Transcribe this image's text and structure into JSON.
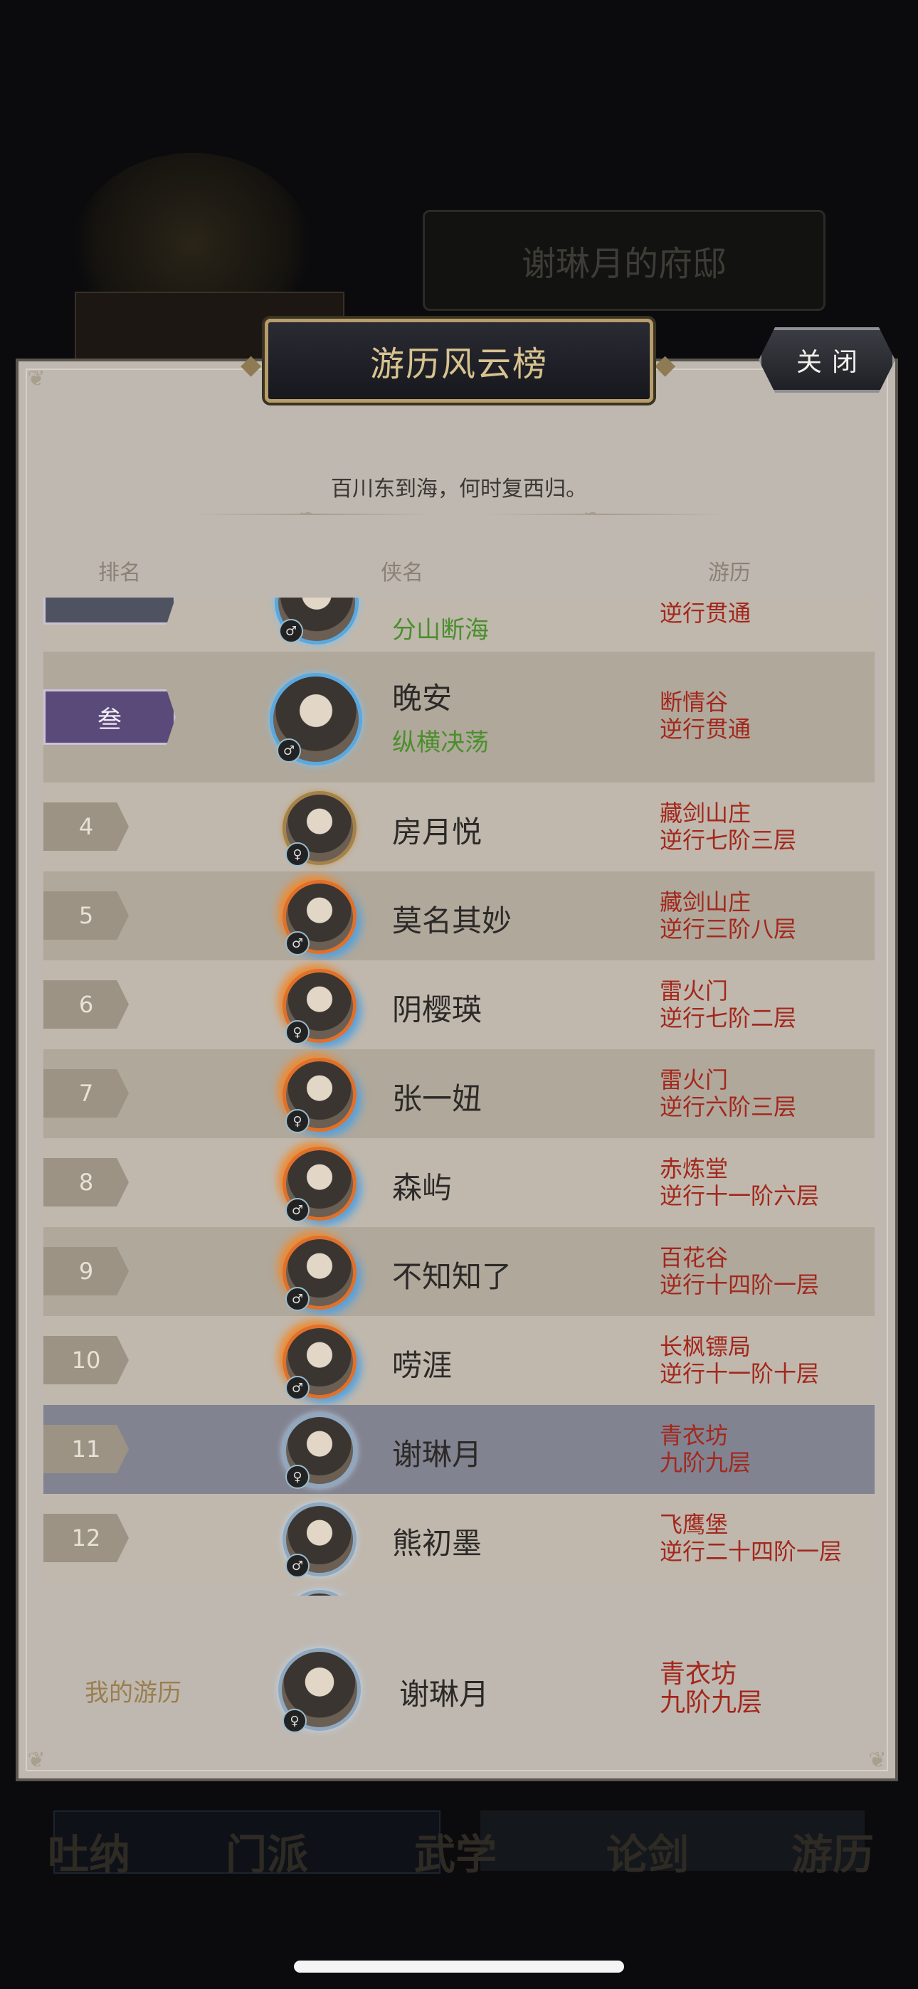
{
  "background": {
    "mansion_title": "谢琳月的府邸",
    "nav_items": [
      "吐纳",
      "门派",
      "武学",
      "论剑",
      "游历"
    ]
  },
  "modal": {
    "title": "游历风云榜",
    "close_label": "关闭",
    "subtitle": "百川东到海，何时复西归。",
    "columns": {
      "rank": "排名",
      "name": "侠名",
      "record": "游历"
    }
  },
  "rankings": [
    {
      "rank": "",
      "name": "",
      "title": "分山断海",
      "sect": "",
      "progress": "逆行贯通",
      "avatar": "hero-avatar-icon",
      "gender": "male",
      "style": "badge-grey"
    },
    {
      "rank": "叁",
      "name": "晚安",
      "title": "纵横决荡",
      "sect": "断情谷",
      "progress": "逆行贯通",
      "avatar": "hero-avatar-icon",
      "gender": "male",
      "style": "badge"
    },
    {
      "rank": "4",
      "name": "房月悦",
      "title": "",
      "sect": "藏剑山庄",
      "progress": "逆行七阶三层",
      "avatar": "hero-avatar-icon",
      "gender": "female",
      "style": "gold"
    },
    {
      "rank": "5",
      "name": "莫名其妙",
      "title": "",
      "sect": "藏剑山庄",
      "progress": "逆行三阶八层",
      "avatar": "hero-avatar-icon",
      "gender": "male",
      "style": "fire"
    },
    {
      "rank": "6",
      "name": "阴樱瑛",
      "title": "",
      "sect": "雷火门",
      "progress": "逆行七阶二层",
      "avatar": "hero-avatar-icon",
      "gender": "female",
      "style": "fire"
    },
    {
      "rank": "7",
      "name": "张一妞",
      "title": "",
      "sect": "雷火门",
      "progress": "逆行六阶三层",
      "avatar": "hero-avatar-icon",
      "gender": "female",
      "style": "fire"
    },
    {
      "rank": "8",
      "name": "森屿",
      "title": "",
      "sect": "赤炼堂",
      "progress": "逆行十一阶六层",
      "avatar": "hero-avatar-icon",
      "gender": "male",
      "style": "fire"
    },
    {
      "rank": "9",
      "name": "不知知了",
      "title": "",
      "sect": "百花谷",
      "progress": "逆行十四阶一层",
      "avatar": "hero-avatar-icon",
      "gender": "male",
      "style": "fire"
    },
    {
      "rank": "10",
      "name": "唠涯",
      "title": "",
      "sect": "长枫镖局",
      "progress": "逆行十一阶十层",
      "avatar": "hero-avatar-icon",
      "gender": "male",
      "style": "fire"
    },
    {
      "rank": "11",
      "name": "谢琳月",
      "title": "",
      "sect": "青衣坊",
      "progress": "九阶九层",
      "avatar": "hero-avatar-icon",
      "gender": "female",
      "style": "pale"
    },
    {
      "rank": "12",
      "name": "熊初墨",
      "title": "",
      "sect": "飞鹰堡",
      "progress": "逆行二十四阶一层",
      "avatar": "hero-avatar-icon",
      "gender": "male",
      "style": "pale"
    }
  ],
  "my_record": {
    "label": "我的游历",
    "name": "谢琳月",
    "sect": "青衣坊",
    "progress": "九阶九层",
    "avatar": "hero-avatar-icon",
    "gender": "female"
  }
}
